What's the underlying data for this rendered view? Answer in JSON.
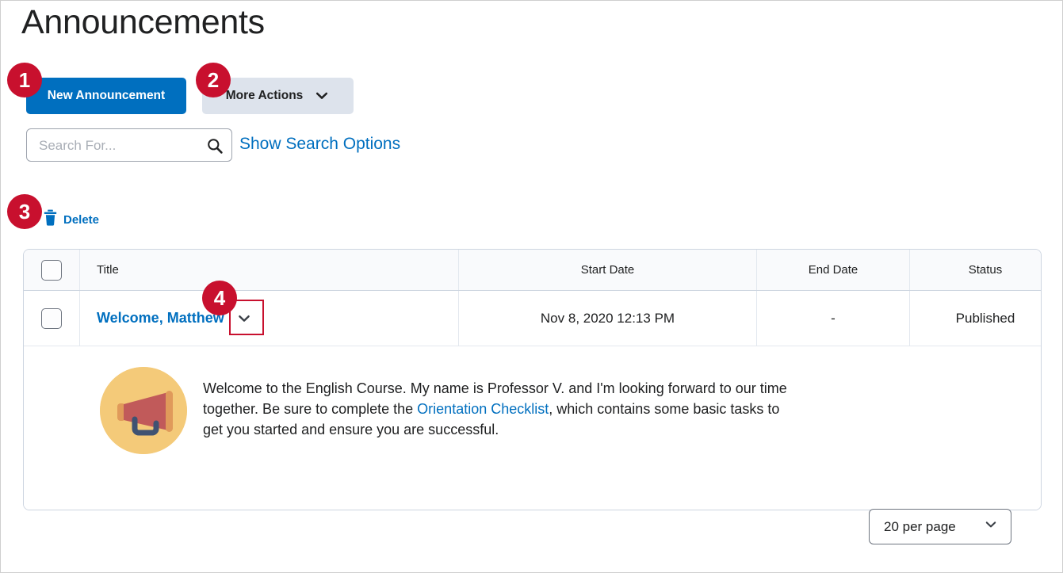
{
  "page": {
    "title": "Announcements"
  },
  "toolbar": {
    "new_announcement_label": "New Announcement",
    "more_actions_label": "More Actions",
    "more_actions_icon": "chevron-down-icon"
  },
  "search": {
    "value": "",
    "placeholder": "Search For...",
    "icon": "search-icon",
    "show_options_label": "Show Search Options"
  },
  "bulk_actions": {
    "delete_label": "Delete",
    "delete_icon": "trash-icon"
  },
  "table": {
    "select_all_checkbox": "select-all-checkbox",
    "columns": [
      {
        "key": "check",
        "label": ""
      },
      {
        "key": "title",
        "label": "Title"
      },
      {
        "key": "start",
        "label": "Start Date"
      },
      {
        "key": "end",
        "label": "End Date"
      },
      {
        "key": "status",
        "label": "Status"
      }
    ],
    "rows": [
      {
        "title": "Welcome, Matthew",
        "start_date": "Nov 8, 2020 12:13 PM",
        "end_date": "-",
        "status": "Published",
        "expand_icon": "chevron-down-icon",
        "expanded": true,
        "body": {
          "avatar_icon": "megaphone-icon",
          "text_before_link": "Welcome to the English Course. My name is Professor V. and I'm looking forward to our time together. Be sure to complete the ",
          "link_text": "Orientation Checklist",
          "text_after_link": ", which contains some basic tasks to get you started and ensure you are successful."
        }
      }
    ]
  },
  "pagination": {
    "per_page_label": "20 per page",
    "icon": "chevron-down-icon"
  },
  "callouts": [
    {
      "number": "1",
      "target": "new-announcement-button"
    },
    {
      "number": "2",
      "target": "more-actions-button"
    },
    {
      "number": "3",
      "target": "delete-button"
    },
    {
      "number": "4",
      "target": "row-expand-chevron"
    }
  ],
  "colors": {
    "primary_blue": "#006fbf",
    "callout_red": "#c8102e",
    "secondary_button_bg": "#dde3ec",
    "table_header_bg": "#f9fafc",
    "avatar_bg": "#f4ca79",
    "megaphone_body": "#c15a5a",
    "megaphone_cap": "#e09a5a",
    "megaphone_handle": "#3f5272"
  }
}
